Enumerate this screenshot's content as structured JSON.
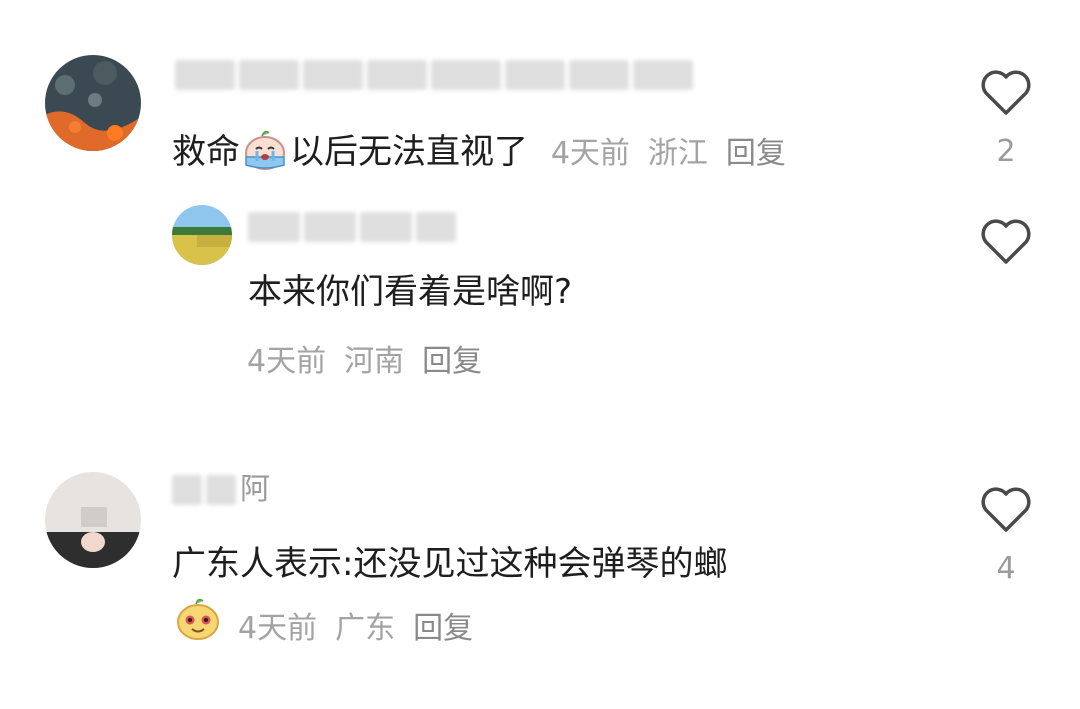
{
  "comments": [
    {
      "text_before_emoji": "救命",
      "emoji": "crying-face-sticker",
      "text_after_emoji": "以后无法直视了",
      "time": "4天前",
      "location": "浙江",
      "reply_label": "回复",
      "like_count": "2"
    },
    {
      "text": "本来你们看着是啥啊?",
      "time": "4天前",
      "location": "河南",
      "reply_label": "回复"
    },
    {
      "name_partial": "阿",
      "text": "广东人表示:还没见过这种会弹琴的螂",
      "time": "4天前",
      "location": "广东",
      "reply_label": "回复",
      "like_count": "4"
    }
  ],
  "colors": {
    "text": "#1e1e1e",
    "meta": "#a3a3a3",
    "heart_stroke": "#4a4a4a",
    "background": "#ffffff"
  }
}
